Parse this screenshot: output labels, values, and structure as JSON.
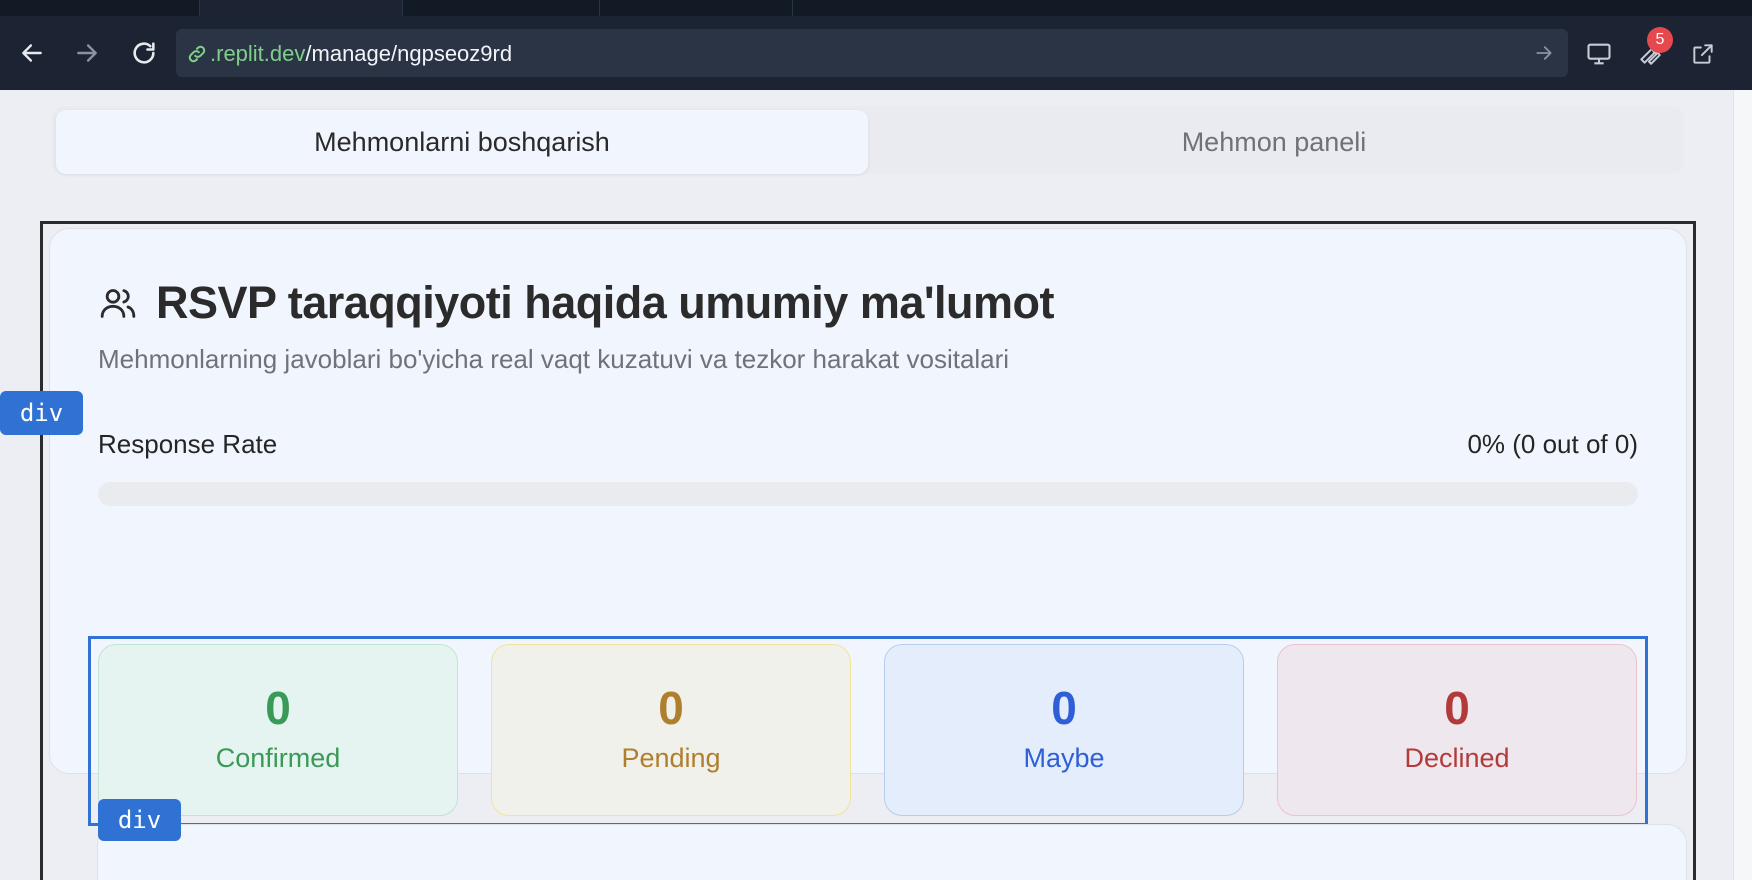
{
  "browser": {
    "url_host": ".replit.dev",
    "url_path": "/manage/ngpseoz9rd",
    "notification_count": "5"
  },
  "page_tabs": {
    "active": "Mehmonlarni boshqarish",
    "inactive": "Mehmon paneli"
  },
  "overview": {
    "title": "RSVP taraqqiyoti haqida umumiy ma'lumot",
    "subtitle": "Mehmonlarning javoblari bo'yicha real vaqt kuzatuvi va tezkor harakat vositalari",
    "rate_label": "Response Rate",
    "rate_value": "0% (0 out of 0)",
    "rate_progress": 0
  },
  "stats": [
    {
      "value": "0",
      "label": "Confirmed",
      "color": "#3a9a57",
      "bg": "#e5f3f1",
      "border": "#bfe6cf"
    },
    {
      "value": "0",
      "label": "Pending",
      "color": "#b07f2e",
      "bg": "#f0f1ea",
      "border": "#f2e39a"
    },
    {
      "value": "0",
      "label": "Maybe",
      "color": "#2f5fd6",
      "bg": "#e4edfb",
      "border": "#b8cdf0"
    },
    {
      "value": "0",
      "label": "Declined",
      "color": "#b23a3a",
      "bg": "#efe7ee",
      "border": "#ecc3cc"
    }
  ],
  "dev_tags": {
    "tag1": "div",
    "tag2": "div"
  }
}
